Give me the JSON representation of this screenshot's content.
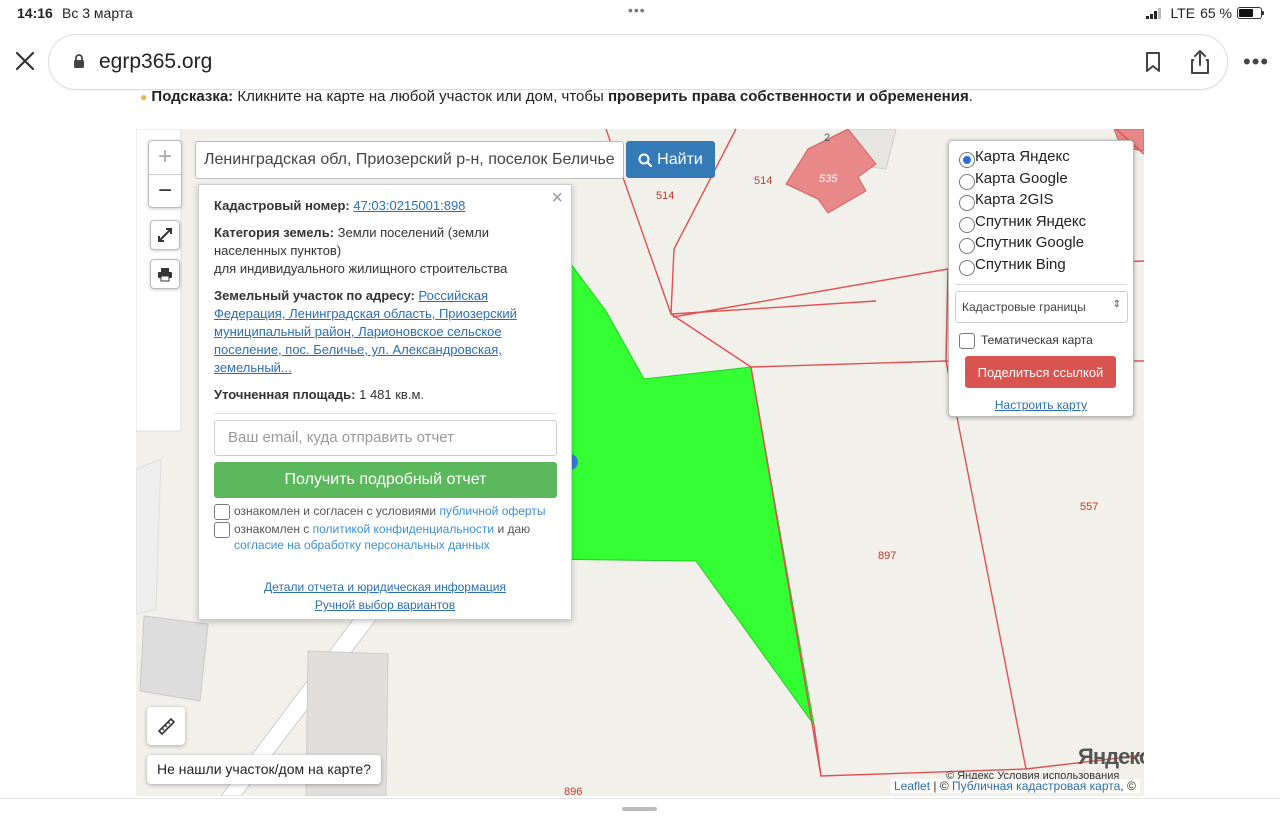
{
  "status": {
    "time": "14:16",
    "date": "Вс 3 марта",
    "network": "LTE",
    "battery": "65 %",
    "battery_level": 0.65
  },
  "browser": {
    "url": "egrp365.org"
  },
  "hint": {
    "label": "Подсказка:",
    "text": " Кликните на карте на любой участок или дом, чтобы ",
    "bold": "проверить права собственности и обременения",
    "tail": "."
  },
  "search": {
    "value": "Ленинградская обл, Приозерский р-н, поселок Беличье",
    "button": "Найти"
  },
  "map": {
    "zoom_in": "+",
    "zoom_out": "−",
    "labels": [
      "2",
      "514",
      "514",
      "535",
      "557",
      "897",
      "896"
    ],
    "not_found": "Не нашли участок/дом на карте?",
    "yandex_logo": "Яндекс",
    "yandex_terms": "© Яндекс  Условия использования",
    "attribution_leaflet": "Leaflet",
    "attribution_sep": " | © ",
    "attribution_pkk": "Публичная кадастровая карта",
    "attribution_tail": ", ©"
  },
  "popup": {
    "cad_label": "Кадастровый номер:",
    "cad_number": "47:03:0215001:898",
    "cat_label": "Категория земель:",
    "cat_value": " Земли поселений (земли населенных пунктов)",
    "use": "для индивидуального жилищного строительства",
    "addr_label": "Земельный участок по адресу:",
    "addr_value": "Российская Федерация, Ленинградская область, Приозерский муниципальный район, Ларионовское сельское поселение, пос. Беличье, ул. Александровская, земельный...",
    "area_label": "Уточненная площадь:",
    "area_value": " 1 481 кв.м.",
    "email_placeholder": "Ваш email, куда отправить отчет",
    "report_button": "Получить подробный отчет",
    "agree1_text": "ознакомлен и согласен с условиями ",
    "agree1_link": "публичной оферты",
    "agree2_text": "ознакомлен с ",
    "agree2_link": "политикой конфиденциальности",
    "agree2_mid": " и даю ",
    "agree2_link2": "согласие на обработку персональных данных",
    "details_link": "Детали отчета и юридическая информация",
    "manual_link": "Ручной выбор вариантов"
  },
  "layers": {
    "items": [
      {
        "label": "Карта Яндекс",
        "selected": true
      },
      {
        "label": "Карта Google",
        "selected": false
      },
      {
        "label": "Карта 2GIS",
        "selected": false
      },
      {
        "label": "Спутник Яндекс",
        "selected": false
      },
      {
        "label": "Спутник Google",
        "selected": false
      },
      {
        "label": "Спутник Bing",
        "selected": false
      }
    ],
    "overlay_select": "Кадастровые границы",
    "thematic": "Тематическая карта",
    "share": "Поделиться ссылкой",
    "setup": "Настроить карту"
  },
  "colors": {
    "parcel": "#33ff33",
    "boundary": "#e05050",
    "search_btn": "#337ab7",
    "report_btn": "#5cb85c",
    "share_btn": "#d9534f"
  }
}
